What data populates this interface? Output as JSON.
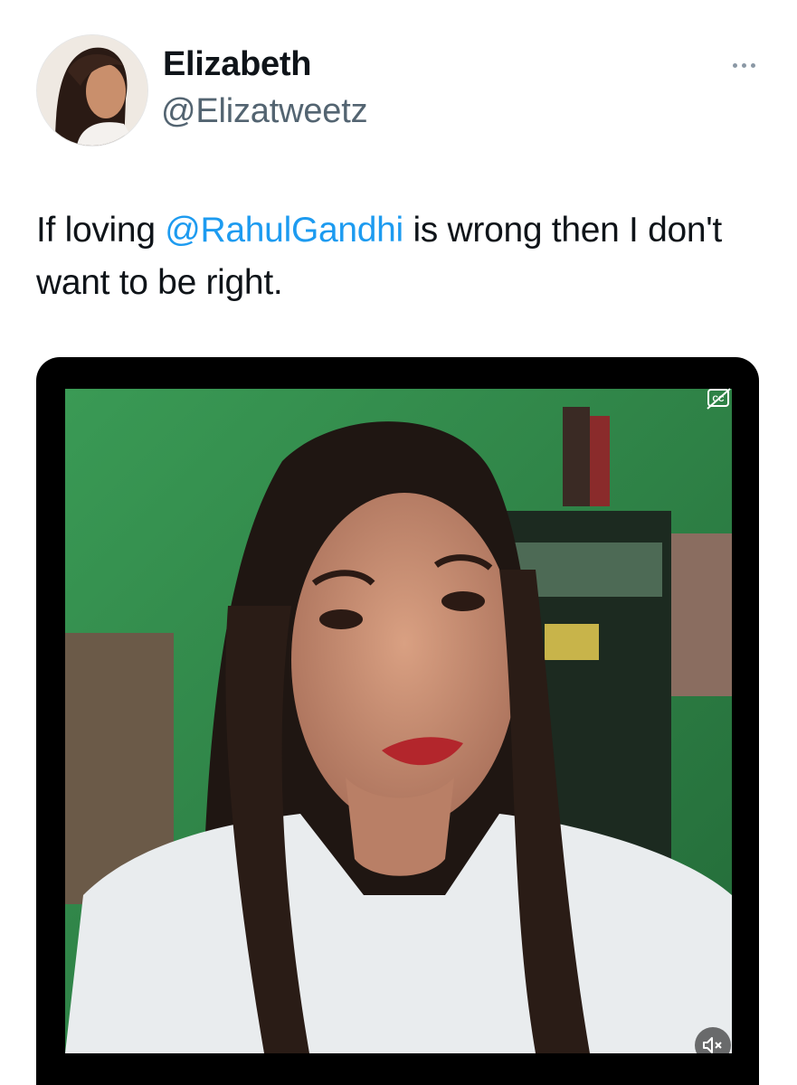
{
  "tweet": {
    "author": {
      "display_name": "Elizabeth",
      "handle": "@Elizatweetz",
      "avatar_icon": "profile-photo"
    },
    "text_before": "If loving ",
    "mention": "@RahulGandhi",
    "text_after": " is wrong then I don't want to be right.",
    "more_icon": "ellipsis-icon"
  },
  "video": {
    "captions_icon": "closed-captions-icon",
    "mute_icon": "muted-speaker-icon"
  },
  "colors": {
    "link": "#1d9bf0",
    "handle": "#536471",
    "text": "#0f1419",
    "video_wall": "#2f8a4a"
  }
}
